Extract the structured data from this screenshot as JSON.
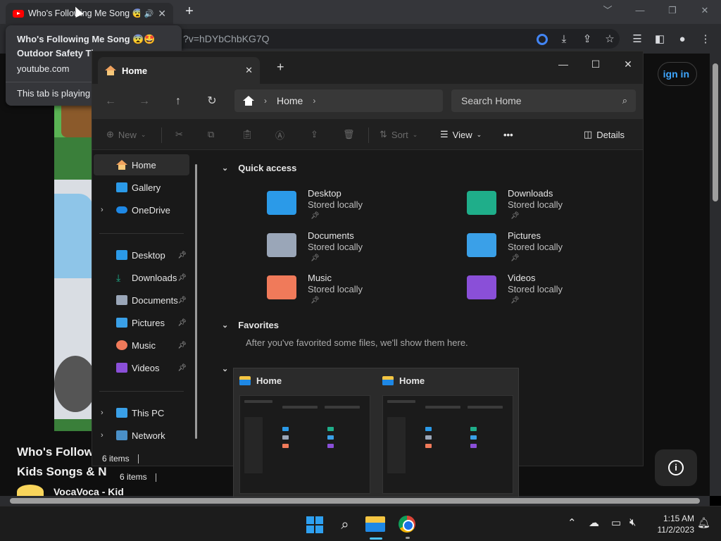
{
  "chrome": {
    "tab_title": "Who's Following Me Song 😨🤩",
    "tab_close": "✕",
    "new_tab": "+",
    "url_fragment": "?v=hDYbChbKG7Q",
    "window_controls": [
      "﹀",
      "—",
      "❐",
      "✕"
    ],
    "toolbar_icons": [
      "google-lens-icon",
      "install-icon",
      "share-icon",
      "bookmark-star-icon",
      "reading-list-icon",
      "side-panel-icon",
      "profile-icon",
      "menu-kebab-icon"
    ]
  },
  "hovercard": {
    "title_line1": "Who's Following Me Song 😨🤩",
    "title_line2": "Outdoor Safety Ti",
    "domain": "youtube.com",
    "playing": "This tab is playing"
  },
  "youtube": {
    "sign_in": "ign in",
    "video_title_line1": "Who's Follow",
    "video_title_line2": "Kids Songs & N",
    "channel": "VocaVoca - Kid",
    "info_icon": "i"
  },
  "explorer": {
    "tab_title": "Home",
    "tab_close": "✕",
    "add_tab": "+",
    "window_controls": [
      "—",
      "☐",
      "✕"
    ],
    "breadcrumb": [
      "Home"
    ],
    "search_placeholder": "Search Home",
    "cmd": {
      "new": "New",
      "sort": "Sort",
      "view": "View",
      "more": "•••",
      "details": "Details"
    },
    "nav": {
      "home": "Home",
      "gallery": "Gallery",
      "onedrive": "OneDrive",
      "desktop": "Desktop",
      "downloads": "Downloads",
      "documents": "Documents",
      "pictures": "Pictures",
      "music": "Music",
      "videos": "Videos",
      "this_pc": "This PC",
      "network": "Network"
    },
    "quick_access_label": "Quick access",
    "quick_access": [
      {
        "name": "Desktop",
        "sub": "Stored locally",
        "color": "#2b9ae8"
      },
      {
        "name": "Downloads",
        "sub": "Stored locally",
        "color": "#1fae8a"
      },
      {
        "name": "Documents",
        "sub": "Stored locally",
        "color": "#9aa6b8"
      },
      {
        "name": "Pictures",
        "sub": "Stored locally",
        "color": "#3aa0e8"
      },
      {
        "name": "Music",
        "sub": "Stored locally",
        "color": "#f07a5a"
      },
      {
        "name": "Videos",
        "sub": "Stored locally",
        "color": "#8a4fd8"
      }
    ],
    "favorites_label": "Favorites",
    "favorites_empty": "After you've favorited some files, we'll show them here.",
    "status_items": "6 items"
  },
  "thumbnails": [
    {
      "title": "Home"
    },
    {
      "title": "Home"
    }
  ],
  "behind_status_items": "6 items",
  "taskbar": {
    "time": "1:15 AM",
    "date": "11/2/2023"
  }
}
